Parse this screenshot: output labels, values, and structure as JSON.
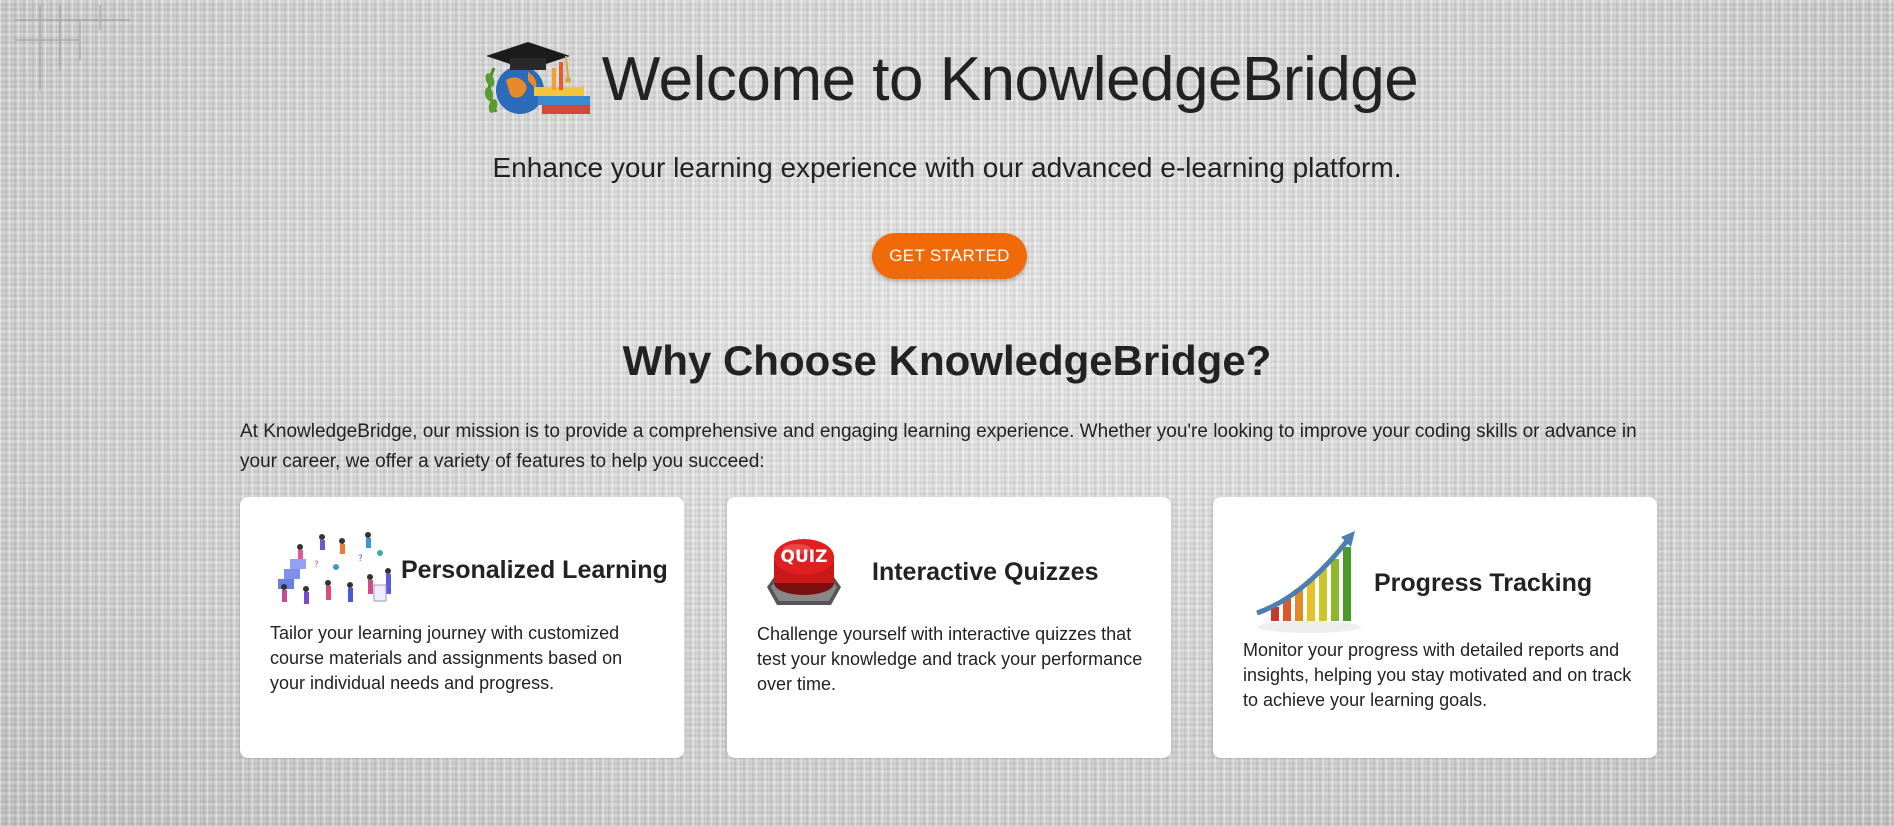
{
  "hero": {
    "title": "Welcome to KnowledgeBridge",
    "subtitle": "Enhance your learning experience with our advanced e-learning platform.",
    "cta_label": "GET STARTED",
    "cta_color": "#f06a0a"
  },
  "why": {
    "title": "Why Choose KnowledgeBridge?",
    "mission": "At KnowledgeBridge, our mission is to provide a comprehensive and engaging learning experience. Whether you're looking to improve your coding skills or advance in your career, we offer a variety of features to help you succeed:"
  },
  "features": [
    {
      "title": "Personalized Learning",
      "text": "Tailor your learning journey with customized course materials and assignments based on your individual needs and progress.",
      "icon": "people-learning-icon"
    },
    {
      "title": "Interactive Quizzes",
      "text": "Challenge yourself with interactive quizzes that test your knowledge and track your performance over time.",
      "icon": "quiz-button-icon",
      "icon_text": "QUIZ"
    },
    {
      "title": "Progress Tracking",
      "text": "Monitor your progress with detailed reports and insights, helping you stay motivated and on track to achieve your learning goals.",
      "icon": "growth-chart-icon"
    }
  ]
}
